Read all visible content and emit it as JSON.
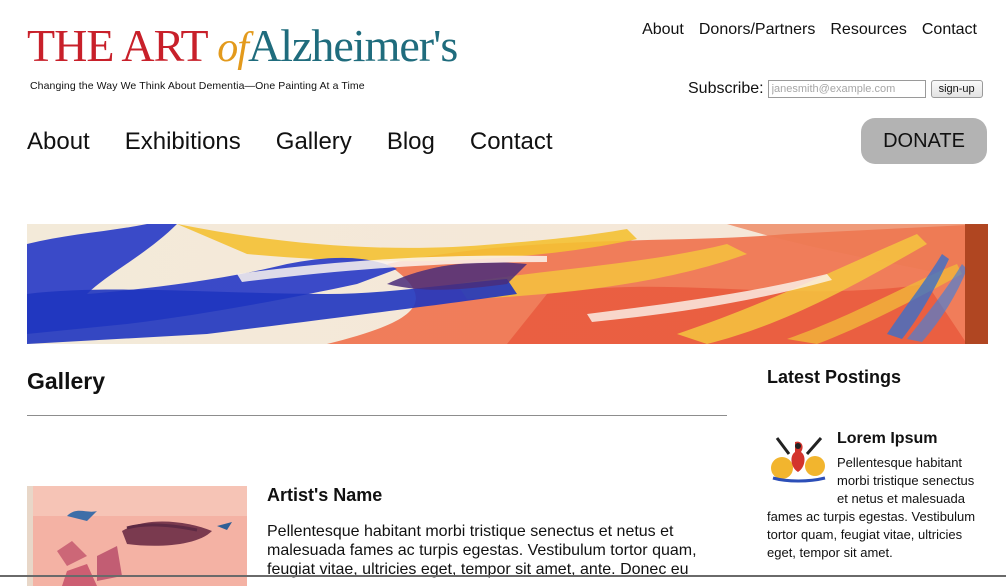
{
  "brand": {
    "logo_the": "THE ART",
    "logo_of": "of",
    "logo_alz": "Alzheimer's",
    "tagline": "Changing the Way We Think About Dementia—One Painting At a Time",
    "colors": {
      "red": "#c8202a",
      "gold": "#e39a1c",
      "teal": "#1f6c7d"
    }
  },
  "top_nav": [
    "About",
    "Donors/Partners",
    "Resources",
    "Contact"
  ],
  "subscribe": {
    "label": "Subscribe:",
    "placeholder": "janesmith@example.com",
    "button": "sign-up"
  },
  "main_nav": [
    "About",
    "Exhibitions",
    "Gallery",
    "Blog",
    "Contact"
  ],
  "donate_label": "DONATE",
  "page": {
    "title": "Gallery",
    "artwork": {
      "artist_name": "Artist's Name",
      "description": "Pellentesque habitant morbi tristique senectus et netus et malesuada fames ac turpis egestas. Vestibulum tortor quam, feugiat vitae, ultricies eget, tempor sit amet, ante. Donec eu"
    }
  },
  "sidebar": {
    "title": "Latest Postings",
    "post": {
      "title": "Lorem Ipsum",
      "body_indented": "Pellentesque habitant morbi tristique senectus et netus et malesuada",
      "body_rest": "fames ac turpis egestas. Vestibulum tortor quam, feugiat vitae, ultricies eget, tempor sit amet."
    }
  }
}
